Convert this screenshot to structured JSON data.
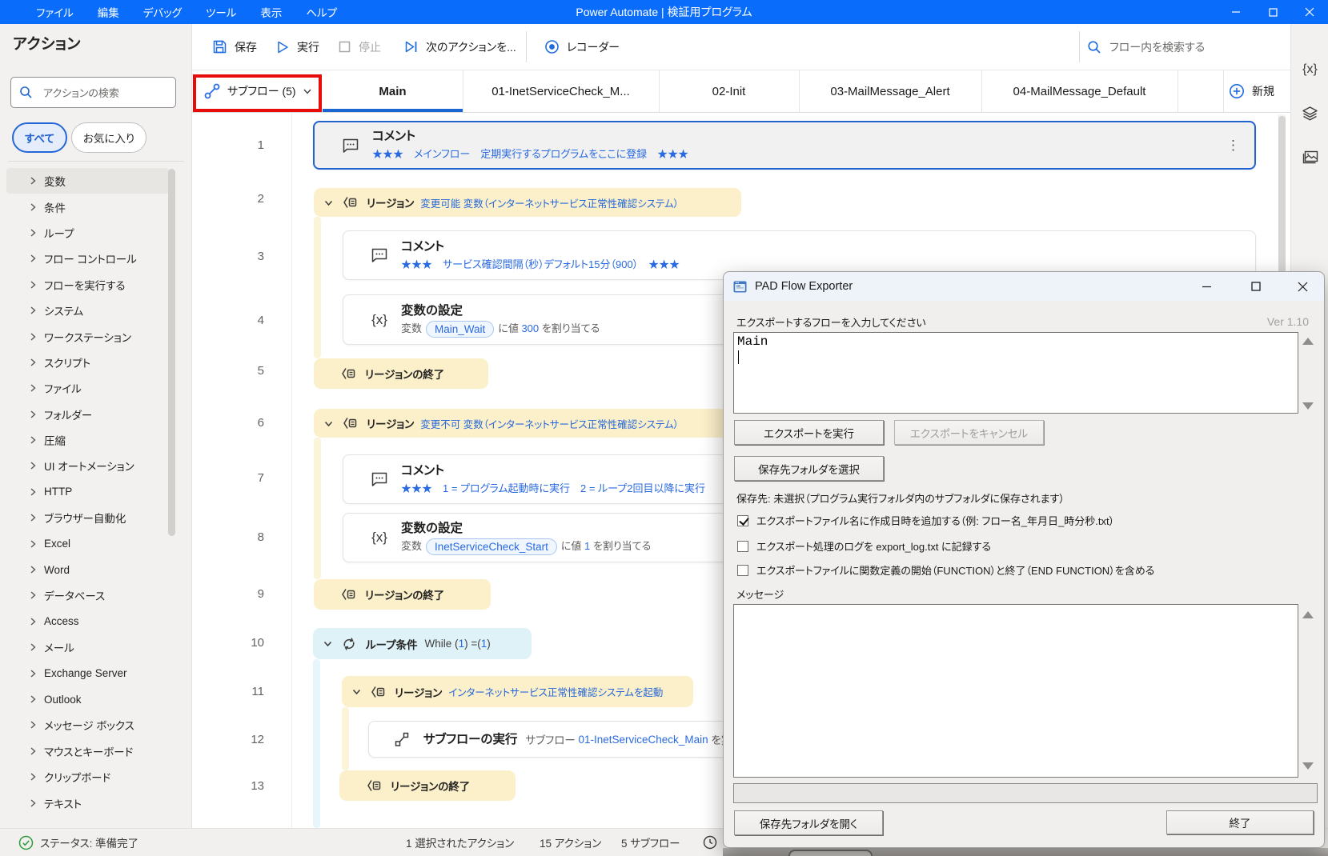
{
  "window": {
    "menus": [
      "ファイル",
      "編集",
      "デバッグ",
      "ツール",
      "表示",
      "ヘルプ"
    ],
    "title": "Power Automate | 検証用プログラム"
  },
  "sidebar": {
    "title": "アクション",
    "search_placeholder": "アクションの検索",
    "filter_all": "すべて",
    "filter_favorites": "お気に入り",
    "selected_category": "変数",
    "categories": [
      "変数",
      "条件",
      "ループ",
      "フロー コントロール",
      "フローを実行する",
      "システム",
      "ワークステーション",
      "スクリプト",
      "ファイル",
      "フォルダー",
      "圧縮",
      "UI オートメーション",
      "HTTP",
      "ブラウザー自動化",
      "Excel",
      "Word",
      "データベース",
      "Access",
      "メール",
      "Exchange Server",
      "Outlook",
      "メッセージ ボックス",
      "マウスとキーボード",
      "クリップボード",
      "テキスト"
    ]
  },
  "toolbar": {
    "save": "保存",
    "run": "実行",
    "stop": "停止",
    "next_action": "次のアクションを...",
    "recorder": "レコーダー",
    "search_placeholder": "フロー内を検索する"
  },
  "tabs": {
    "subflows_button": "サブフロー (5)",
    "items": [
      "Main",
      "01-InetServiceCheck_M...",
      "02-Init",
      "03-MailMessage_Alert",
      "04-MailMessage_Default"
    ],
    "active_tab": "Main",
    "new_tab": "新規"
  },
  "flow": {
    "rows": [
      {
        "num": "1",
        "type": "comment",
        "title": "コメント",
        "subtitle": "★★★　メインフロー　定期実行するプログラムをここに登録　★★★"
      },
      {
        "num": "2",
        "type": "region",
        "label": "リージョン",
        "text": "変更可能 変数（インターネットサービス正常性確認システム）"
      },
      {
        "num": "3",
        "type": "comment",
        "title": "コメント",
        "subtitle": "★★★　サービス確認間隔（秒）デフォルト15分（900）　★★★"
      },
      {
        "num": "4",
        "type": "set-variable",
        "title": "変数の設定",
        "prefix": "変数",
        "variable": "Main_Wait",
        "mid": "に値",
        "value": "300",
        "suffix": "を割り当てる"
      },
      {
        "num": "5",
        "type": "region-end",
        "label": "リージョンの終了"
      },
      {
        "num": "6",
        "type": "region",
        "label": "リージョン",
        "text": "変更不可 変数（インターネットサービス正常性確認システム）"
      },
      {
        "num": "7",
        "type": "comment",
        "title": "コメント",
        "subtitle": "★★★　1 = プログラム起動時に実行　2 = ループ2回目以降に実行"
      },
      {
        "num": "8",
        "type": "set-variable",
        "title": "変数の設定",
        "prefix": "変数",
        "variable": "InetServiceCheck_Start",
        "mid": "に値",
        "value": "1",
        "suffix": "を割り当てる"
      },
      {
        "num": "9",
        "type": "region-end",
        "label": "リージョンの終了"
      },
      {
        "num": "10",
        "type": "loop",
        "label": "ループ条件",
        "expr_1": "While (",
        "expr_2": "1",
        "expr_3": ") =(",
        "expr_4": "1",
        "expr_5": ")"
      },
      {
        "num": "11",
        "type": "region",
        "label": "リージョン",
        "text": "インターネットサービス正常性確認システムを起動"
      },
      {
        "num": "12",
        "type": "run-subflow",
        "title": "サブフローの実行",
        "prefix": "サブフロー",
        "link": "01-InetServiceCheck_Main",
        "suffix": "を実"
      },
      {
        "num": "13",
        "type": "region-end",
        "label": "リージョンの終了"
      }
    ]
  },
  "status": {
    "ready": "ステータス: 準備完了",
    "selected_actions": "1 選択されたアクション",
    "actions_count": "15 アクション",
    "subflows_count": "5 サブフロー"
  },
  "dialog": {
    "title": "PAD Flow Exporter",
    "version": "Ver 1.10",
    "prompt": "エクスポートするフローを入力してください",
    "flow_input_value": "Main",
    "run_export": "エクスポートを実行",
    "cancel_export": "エクスポートをキャンセル",
    "choose_folder": "保存先フォルダを選択",
    "dest_label": "保存先: 未選択（プログラム実行フォルダ内のサブフォルダに保存されます）",
    "checkboxes": [
      {
        "label": "エクスポートファイル名に作成日時を追加する（例: フロー名_年月日_時分秒.txt）",
        "checked": true
      },
      {
        "label": "エクスポート処理のログを export_log.txt に記録する",
        "checked": false
      },
      {
        "label": "エクスポートファイルに関数定義の開始（FUNCTION）と終了（END FUNCTION）を含める",
        "checked": false
      }
    ],
    "message_label": "メッセージ",
    "message_value": "",
    "open_folder": "保存先フォルダを開く",
    "exit": "終了"
  },
  "colors": {
    "titlebar": "#0a6cfb",
    "accent_blue": "#2163cf",
    "link_blue": "#2a6ae0",
    "region_yellow": "#fbf0ca",
    "loop_cyan": "#def2f8",
    "annotation_red": "#e60c0c"
  }
}
